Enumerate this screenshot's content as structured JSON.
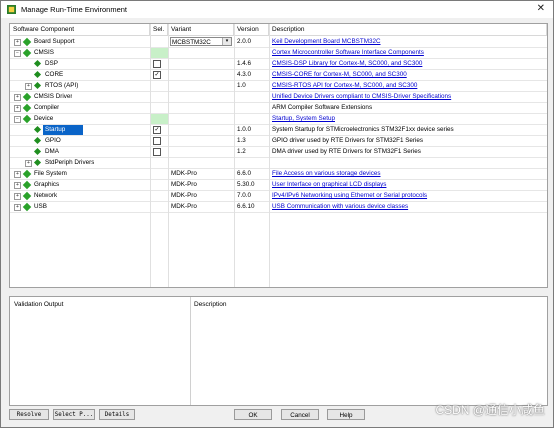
{
  "window": {
    "title": "Manage Run-Time Environment",
    "close_glyph": "✕"
  },
  "columns": {
    "component": "Software Component",
    "sel": "Sel.",
    "variant": "Variant",
    "version": "Version",
    "description": "Description"
  },
  "rows": [
    {
      "indent": 0,
      "expander": "+",
      "icon": "component-icon",
      "name": "Board Support",
      "variant": "MCBSTM32C",
      "variant_dropdown": true,
      "version": "2.0.0",
      "description": "Keil Development Board MCBSTM32C",
      "desc_link": true
    },
    {
      "indent": 0,
      "expander": "−",
      "icon": "component-icon",
      "name": "CMSIS",
      "green": true,
      "description": "Cortex Microcontroller Software Interface Components",
      "desc_link": true
    },
    {
      "indent": 1,
      "icon": "component-icon",
      "name": "DSP",
      "checkbox": true,
      "checked": false,
      "version": "1.4.6",
      "description": "CMSIS-DSP Library for Cortex-M, SC000, and SC300",
      "desc_link": true
    },
    {
      "indent": 1,
      "icon": "component-icon",
      "name": "CORE",
      "checkbox": true,
      "checked": true,
      "version": "4.3.0",
      "description": "CMSIS-CORE for Cortex-M, SC000, and SC300",
      "desc_link": true
    },
    {
      "indent": 1,
      "expander": "+",
      "icon": "component-icon",
      "name": "RTOS (API)",
      "version": "1.0",
      "description": "CMSIS-RTOS API for Cortex-M, SC000, and SC300",
      "desc_link": true
    },
    {
      "indent": 0,
      "expander": "+",
      "icon": "component-icon",
      "name": "CMSIS Driver",
      "description": "Unified Device Drivers compliant to CMSIS-Driver Specifications",
      "desc_link": true
    },
    {
      "indent": 0,
      "expander": "+",
      "icon": "component-icon",
      "name": "Compiler",
      "description": "ARM Compiler Software Extensions",
      "desc_link": false
    },
    {
      "indent": 0,
      "expander": "−",
      "icon": "component-icon",
      "name": "Device",
      "green": true,
      "description": "Startup, System Setup",
      "desc_link": true
    },
    {
      "indent": 1,
      "icon": "component-icon",
      "name": "Startup",
      "selected": true,
      "checkbox": true,
      "checked": true,
      "version": "1.0.0",
      "description": "System Startup for STMicroelectronics STM32F1xx device series",
      "desc_link": false
    },
    {
      "indent": 1,
      "icon": "component-icon",
      "name": "GPIO",
      "checkbox": true,
      "checked": false,
      "version": "1.3",
      "description": "GPIO driver used by RTE Drivers for STM32F1 Series",
      "desc_link": false
    },
    {
      "indent": 1,
      "icon": "component-icon",
      "name": "DMA",
      "checkbox": true,
      "checked": false,
      "version": "1.2",
      "description": "DMA driver used by RTE Drivers for STM32F1 Series",
      "desc_link": false
    },
    {
      "indent": 1,
      "expander": "+",
      "icon": "component-icon",
      "name": "StdPeriph Drivers"
    },
    {
      "indent": 0,
      "expander": "+",
      "icon": "component-icon",
      "name": "File System",
      "variant": "MDK-Pro",
      "version": "6.6.0",
      "description": "File Access on various storage devices",
      "desc_link": true
    },
    {
      "indent": 0,
      "expander": "+",
      "icon": "component-icon",
      "name": "Graphics",
      "variant": "MDK-Pro",
      "version": "5.30.0",
      "description": "User Interface on graphical LCD displays",
      "desc_link": true
    },
    {
      "indent": 0,
      "expander": "+",
      "icon": "component-icon",
      "name": "Network",
      "variant": "MDK-Pro",
      "version": "7.0.0",
      "description": "IPv4/IPv6 Networking using Ethernet or Serial protocols",
      "desc_link": true
    },
    {
      "indent": 0,
      "expander": "+",
      "icon": "component-icon",
      "name": "USB",
      "variant": "MDK-Pro",
      "version": "6.6.10",
      "description": "USB Communication with various device classes",
      "desc_link": true
    }
  ],
  "bottom": {
    "validation_label": "Validation Output",
    "description_label": "Description"
  },
  "buttons": {
    "resolve": "Resolve",
    "select_packs": "Select P...",
    "details": "Details",
    "ok": "OK",
    "cancel": "Cancel",
    "help": "Help"
  },
  "watermark": "CSDN @通信小咸鱼",
  "colors": {
    "selection": "#0a64c8",
    "green_highlight": "#c8f0c8",
    "link": "#0000d0",
    "component_icon": "#2aa22a"
  }
}
